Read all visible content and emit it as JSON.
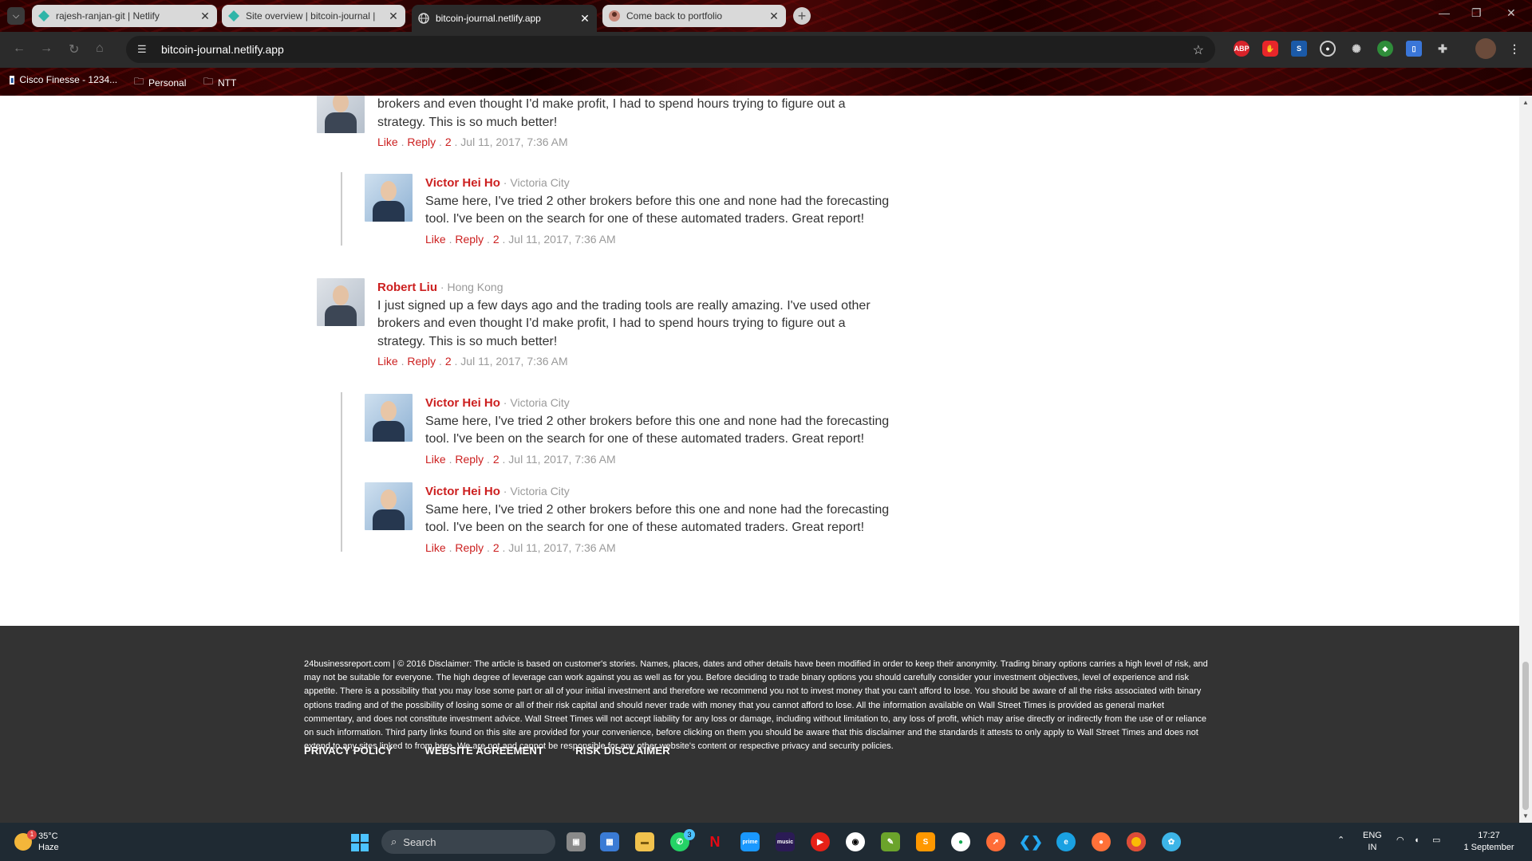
{
  "browser": {
    "tabs": [
      {
        "title": "rajesh-ranjan-git | Netlify",
        "favicon": "netlify-icon",
        "active": false
      },
      {
        "title": "Site overview | bitcoin-journal |",
        "favicon": "netlify-icon",
        "active": false
      },
      {
        "title": "bitcoin-journal.netlify.app",
        "favicon": "globe-icon",
        "active": true
      },
      {
        "title": "Come back to portfolio",
        "favicon": "portfolio-icon",
        "active": false
      }
    ],
    "url": "bitcoin-journal.netlify.app",
    "bookmarks": [
      {
        "label": "Cisco Finesse - 1234...",
        "icon": "cisco-icon"
      },
      {
        "label": "Personal",
        "icon": "folder-icon"
      },
      {
        "label": "NTT",
        "icon": "folder-icon"
      }
    ],
    "extensions": [
      "ABP",
      "adblock",
      "S",
      "record",
      "settings",
      "shield",
      "docs",
      "puzzle"
    ]
  },
  "comments": [
    {
      "name": "",
      "location": "",
      "text": "brokers and even thought I'd make profit, I had to spend hours trying to figure out a strategy. This is so much better!",
      "like": "Like",
      "reply": "Reply",
      "count": "2",
      "date": "Jul 11, 2017, 7:36 AM"
    },
    {
      "name": "Victor Hei Ho",
      "location": "Victoria City",
      "text": "Same here, I've tried 2 other brokers before this one and none had the forecasting tool. I've been on the search for one of these automated traders. Great report!",
      "like": "Like",
      "reply": "Reply",
      "count": "2",
      "date": "Jul 11, 2017, 7:36 AM"
    },
    {
      "name": "Robert Liu",
      "location": "Hong Kong",
      "text": "I just signed up a few days ago and the trading tools are really amazing. I've used other brokers and even thought I'd make profit, I had to spend hours trying to figure out a strategy. This is so much better!",
      "like": "Like",
      "reply": "Reply",
      "count": "2",
      "date": "Jul 11, 2017, 7:36 AM"
    },
    {
      "name": "Victor Hei Ho",
      "location": "Victoria City",
      "text": "Same here, I've tried 2 other brokers before this one and none had the forecasting tool. I've been on the search for one of these automated traders. Great report!",
      "like": "Like",
      "reply": "Reply",
      "count": "2",
      "date": "Jul 11, 2017, 7:36 AM"
    },
    {
      "name": "Victor Hei Ho",
      "location": "Victoria City",
      "text": "Same here, I've tried 2 other brokers before this one and none had the forecasting tool. I've been on the search for one of these automated traders. Great report!",
      "like": "Like",
      "reply": "Reply",
      "count": "2",
      "date": "Jul 11, 2017, 7:36 AM"
    }
  ],
  "separator": " . ",
  "loc_sep": " · ",
  "footer": {
    "disclaimer": "24businessreport.com | © 2016 Disclaimer: The article is based on customer's stories. Names, places, dates and other details have been modified in order to keep their anonymity. Trading binary options carries a high level of risk, and may not be suitable for everyone. The high degree of leverage can work against you as well as for you. Before deciding to trade binary options you should carefully consider your investment objectives, level of experience and risk appetite. There is a possibility that you may lose some part or all of your initial investment and therefore we recommend you not to invest money that you can't afford to lose. You should be aware of all the risks associated with binary options trading and of the possibility of losing some or all of their risk capital and should never trade with money that you cannot afford to lose. All the information available on Wall Street Times is provided as general market commentary, and does not constitute investment advice. Wall Street Times will not accept liability for any loss or damage, including without limitation to, any loss of profit, which may arise directly or indirectly from the use of or reliance on such information. Third party links found on this site are provided for your convenience, before clicking on them you should be aware that this disclaimer and the standards it attests to only apply to Wall Street Times and does not extend to any sites linked to from here. We are not and cannot be responsible for any other website's content or respective privacy and security policies.",
    "links": [
      "PRIVACY POLICY",
      "WEBSITE AGREEMENT",
      "RISK DISCLAIMER"
    ]
  },
  "taskbar": {
    "weather": {
      "temp": "35°C",
      "condition": "Haze",
      "badge": "1"
    },
    "search_placeholder": "Search",
    "whatsapp_badge": "3",
    "lang": "ENG",
    "region": "IN",
    "time": "17:27",
    "date": "1 September"
  },
  "colors": {
    "accent_red": "#cc1f1f",
    "footer_bg": "#333333",
    "taskbar_bg": "#1f2a33"
  }
}
